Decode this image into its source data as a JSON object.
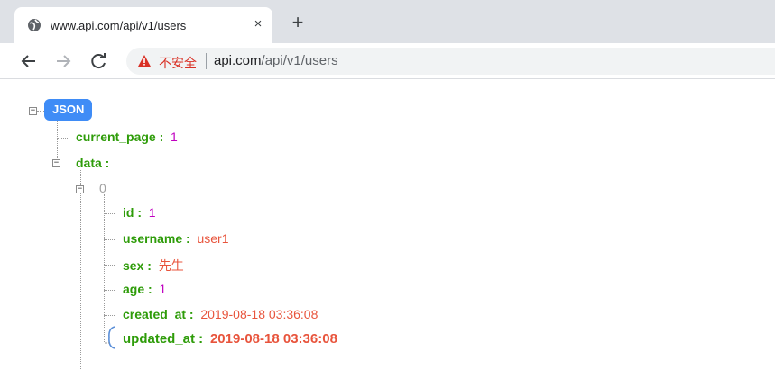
{
  "tab": {
    "title": "www.api.com/api/v1/users",
    "close_glyph": "×",
    "favicon": "globe-icon"
  },
  "newtab_glyph": "+",
  "toolbar": {
    "back_glyph": "←",
    "forward_glyph": "→",
    "reload_glyph": "C",
    "security_label": "不安全",
    "url_host": "api.com",
    "url_path": "/api/v1/users"
  },
  "json_viewer": {
    "root_label": "JSON",
    "rows": {
      "current_page_key": "current_page :",
      "current_page_val": "1",
      "data_key": "data :",
      "index": "0",
      "id_key": "id :",
      "id_val": "1",
      "username_key": "username :",
      "username_val": "user1",
      "sex_key": "sex :",
      "sex_val": "先生",
      "age_key": "age :",
      "age_val": "1",
      "created_at_key": "created_at :",
      "created_at_val": "2019-08-18 03:36:08",
      "updated_at_key": "updated_at :",
      "updated_at_val": "2019-08-18 03:36:08"
    },
    "colors": {
      "key": "#2e9c09",
      "number": "#c000c0",
      "string": "#e8543c",
      "badge": "#3f8cf6"
    }
  }
}
